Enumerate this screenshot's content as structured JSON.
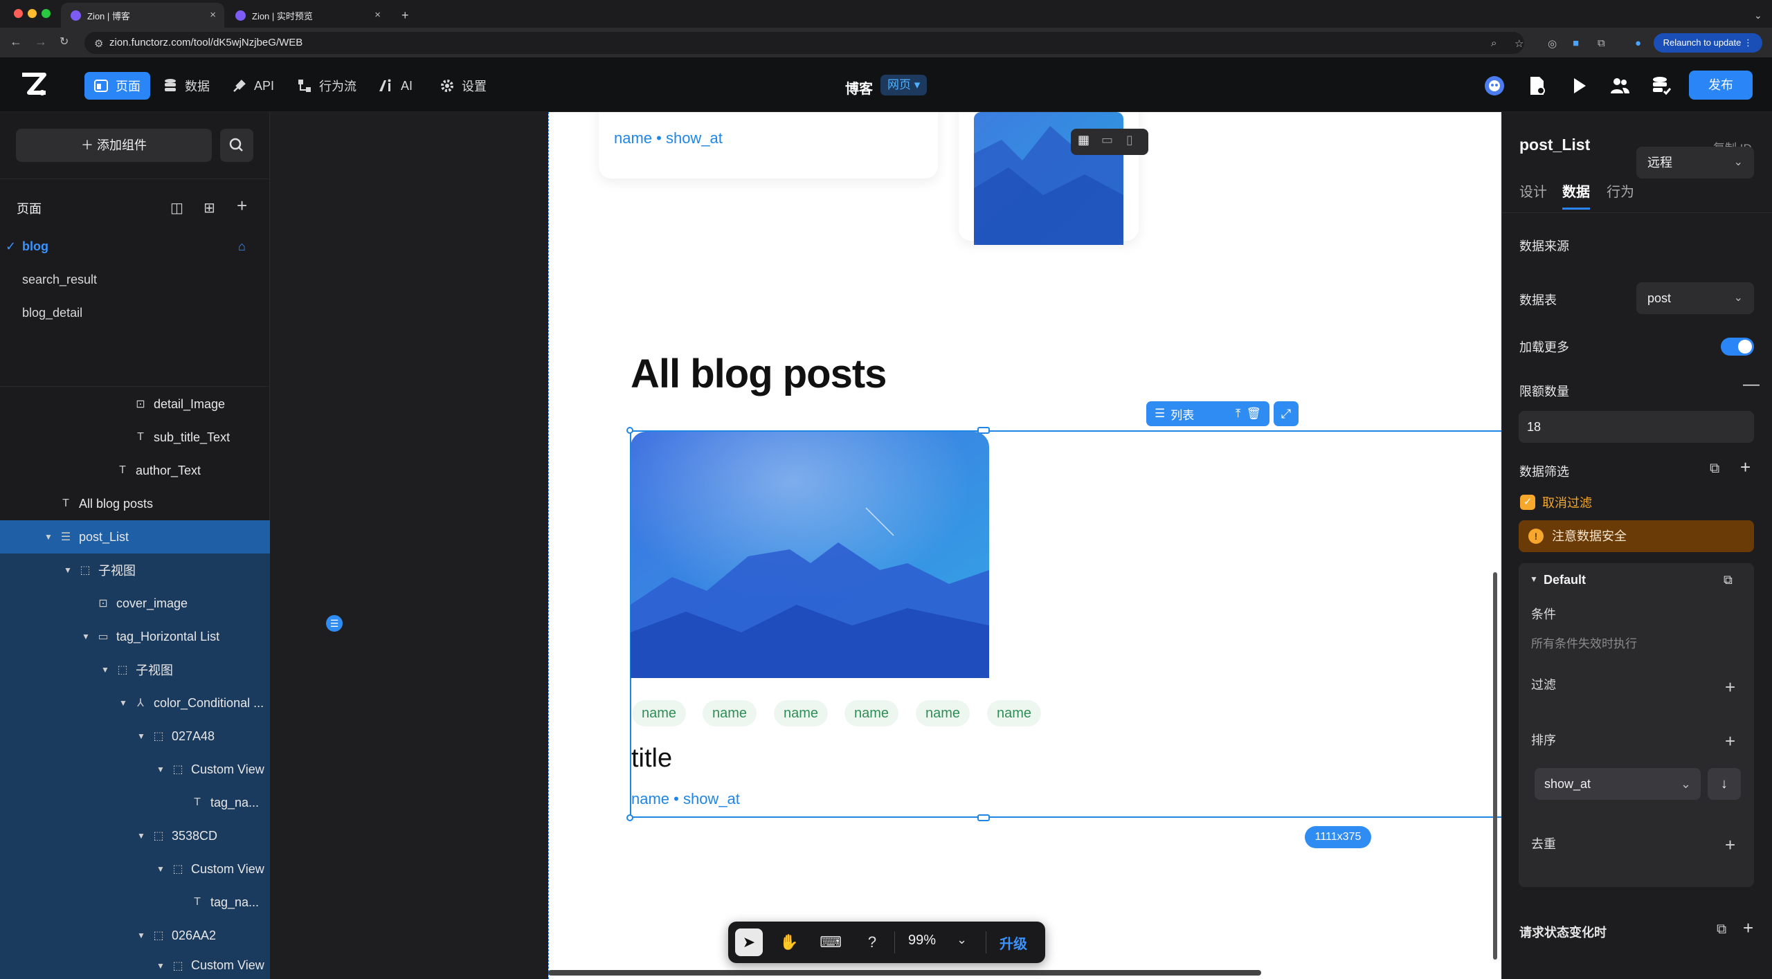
{
  "browser": {
    "tabs": [
      {
        "title": "Zion | 博客"
      },
      {
        "title": "Zion | 实时预览"
      }
    ],
    "url": "zion.functorz.com/tool/dK5wjNzjbeG/WEB",
    "relaunch": "Relaunch to update"
  },
  "header": {
    "nav": [
      {
        "label": "页面",
        "icon": "page-icon"
      },
      {
        "label": "数据",
        "icon": "database-icon"
      },
      {
        "label": "API",
        "icon": "plug-icon"
      },
      {
        "label": "行为流",
        "icon": "flow-icon"
      },
      {
        "label": "AI",
        "icon": "ai-icon"
      },
      {
        "label": "设置",
        "icon": "gear-icon"
      }
    ],
    "page_title": "博客",
    "page_type": "网页 ▾",
    "publish": "发布",
    "accent": "#2a86f6"
  },
  "left": {
    "add_component": "添加组件",
    "pages_heading": "页面",
    "pages": [
      "blog",
      "search_result",
      "blog_detail"
    ],
    "tree": [
      {
        "label": "detail_Image",
        "icon": "image-icon",
        "indent": 6
      },
      {
        "label": "sub_title_Text",
        "icon": "text-icon",
        "indent": 7
      },
      {
        "label": "author_Text",
        "icon": "text-icon",
        "indent": 6
      },
      {
        "label": "All blog posts",
        "icon": "text-icon",
        "indent": 3
      },
      {
        "label": "post_List",
        "icon": "list-icon",
        "indent": 3
      },
      {
        "label": "子视图",
        "icon": "view-icon",
        "indent": 4
      },
      {
        "label": "cover_image",
        "icon": "image-icon",
        "indent": 5
      },
      {
        "label": "tag_Horizontal List",
        "icon": "hlist-icon",
        "indent": 5
      },
      {
        "label": "子视图",
        "icon": "view-icon",
        "indent": 6
      },
      {
        "label": "color_Conditional ...",
        "icon": "conditional-icon",
        "indent": 7
      },
      {
        "label": "027A48",
        "icon": "view-icon",
        "indent": 8
      },
      {
        "label": "Custom View",
        "icon": "view-icon",
        "indent": 9
      },
      {
        "label": "tag_na...",
        "icon": "text-icon",
        "indent": 10
      },
      {
        "label": "3538CD",
        "icon": "view-icon",
        "indent": 8
      },
      {
        "label": "Custom View",
        "icon": "view-icon",
        "indent": 9
      },
      {
        "label": "tag_na...",
        "icon": "text-icon",
        "indent": 10
      },
      {
        "label": "026AA2",
        "icon": "view-icon",
        "indent": 8
      },
      {
        "label": "Custom View",
        "icon": "view-icon",
        "indent": 9
      }
    ]
  },
  "canvas": {
    "top_meta": "name • show_at",
    "heading": "All blog posts",
    "list_label": "列表",
    "tags": [
      "name",
      "name",
      "name",
      "name",
      "name",
      "name"
    ],
    "card_title": "title",
    "card_meta": "name • show_at",
    "size_badge": "1111x375",
    "zoom": "99%",
    "upgrade": "升级"
  },
  "right": {
    "component_name": "post_List",
    "copy_id": "复制 ID",
    "tabs": [
      "设计",
      "数据",
      "行为"
    ],
    "data_source_label": "数据来源",
    "data_source_value": "远程",
    "table_label": "数据表",
    "table_value": "post",
    "load_more_label": "加载更多",
    "limit_label": "限额数量",
    "limit_value": "18",
    "filter_label": "数据筛选",
    "cancel_filter": "取消过滤",
    "warning": "注意数据安全",
    "default_title": "Default",
    "condition_label": "条件",
    "condition_hint": "所有条件失效时执行",
    "filter_row": "过滤",
    "sort_row": "排序",
    "sort_value": "show_at",
    "dedupe_row": "去重",
    "request_state": "请求状态变化时"
  }
}
